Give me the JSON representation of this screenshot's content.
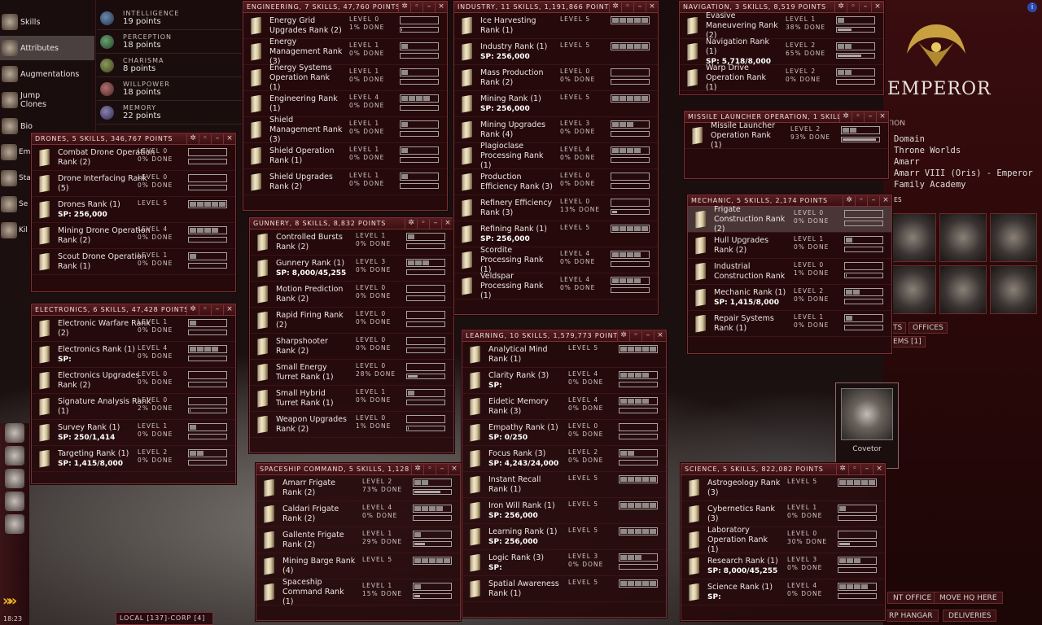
{
  "nav": {
    "items": [
      {
        "label": "Skills"
      },
      {
        "label": "Attributes"
      },
      {
        "label": "Augmentations"
      },
      {
        "label": "Jump\nClones"
      },
      {
        "label": "Bio"
      }
    ],
    "cut_items": [
      {
        "label": "Em His"
      },
      {
        "label": "Sta"
      },
      {
        "label": "Se Sta"
      },
      {
        "label": "Kil Rig"
      }
    ]
  },
  "attributes": [
    {
      "name": "INTELLIGENCE",
      "points": "19 points"
    },
    {
      "name": "PERCEPTION",
      "points": "18 points"
    },
    {
      "name": "CHARISMA",
      "points": "8 points"
    },
    {
      "name": "WILLPOWER",
      "points": "18 points"
    },
    {
      "name": "MEMORY",
      "points": "22 points"
    }
  ],
  "corp": {
    "title": "EMPEROR",
    "section_label": "TION",
    "lines": [
      "Domain",
      "Throne Worlds",
      "Amarr",
      "Amarr VIII (Oris) - Emperor",
      "Family Academy"
    ],
    "es_label": "ES",
    "tabs": [
      "TS",
      "OFFICES",
      "EMS [1]"
    ],
    "covetor": "Covetor",
    "buttons": [
      "NT OFFICE",
      "MOVE HQ HERE",
      "RP HANGAR",
      "DELIVERIES"
    ]
  },
  "misc": {
    "time": "18:23",
    "local_chat": "LOCAL [137]-CORP [4]",
    "info": "i",
    "chevrons": "»»"
  },
  "windows": {
    "drones": {
      "title": "DRONES, 5 SKILLS, 346,767 POINTS",
      "skills": [
        {
          "name": "Combat Drone Operation Rank (2)",
          "level": 0,
          "level_text": "LEVEL 0",
          "done_text": "0% DONE",
          "progress": 0
        },
        {
          "name": "Drone Interfacing Rank (5)",
          "level": 0,
          "level_text": "LEVEL 0",
          "done_text": "0% DONE",
          "progress": 0
        },
        {
          "name": "Drones Rank (1)",
          "level": 5,
          "level_text": "LEVEL 5",
          "done_text": "",
          "progress": null,
          "sp": "SP: 256,000"
        },
        {
          "name": "Mining Drone Operation Rank (2)",
          "level": 4,
          "level_text": "LEVEL 4",
          "done_text": "0% DONE",
          "progress": 0
        },
        {
          "name": "Scout Drone Operation Rank (1)",
          "level": 1,
          "level_text": "LEVEL 1",
          "done_text": "0% DONE",
          "progress": 0
        }
      ]
    },
    "electronics": {
      "title": "ELECTRONICS, 6 SKILLS, 47,428 POINTS",
      "skills": [
        {
          "name": "Electronic Warfare Rank (2)",
          "level": 1,
          "level_text": "LEVEL 1",
          "done_text": "0% DONE",
          "progress": 0
        },
        {
          "name": "Electronics Rank (1)",
          "level": 4,
          "level_text": "LEVEL 4",
          "done_text": "0% DONE",
          "progress": 0,
          "sp": "SP:"
        },
        {
          "name": "Electronics Upgrades Rank (2)",
          "level": 0,
          "level_text": "LEVEL 0",
          "done_text": "0% DONE",
          "progress": 0
        },
        {
          "name": "Signature Analysis Rank (1)",
          "level": 0,
          "level_text": "LEVEL 0",
          "done_text": "2% DONE",
          "progress": 2
        },
        {
          "name": "Survey Rank (1)",
          "level": 1,
          "level_text": "LEVEL 1",
          "done_text": "0% DONE",
          "progress": 0,
          "sp": "SP: 250/1,414"
        },
        {
          "name": "Targeting Rank (1)",
          "level": 2,
          "level_text": "LEVEL 2",
          "done_text": "0% DONE",
          "progress": 0,
          "sp": "SP: 1,415/8,000"
        }
      ]
    },
    "engineering": {
      "title": "ENGINEERING, 7 SKILLS, 47,760 POINTS",
      "skills": [
        {
          "name": "Energy Grid Upgrades Rank (2)",
          "level": 0,
          "level_text": "LEVEL 0",
          "done_text": "1% DONE",
          "progress": 1
        },
        {
          "name": "Energy Management Rank (3)",
          "level": 1,
          "level_text": "LEVEL 1",
          "done_text": "0% DONE",
          "progress": 0
        },
        {
          "name": "Energy Systems Operation Rank (1)",
          "level": 1,
          "level_text": "LEVEL 1",
          "done_text": "0% DONE",
          "progress": 0
        },
        {
          "name": "Engineering Rank (1)",
          "level": 4,
          "level_text": "LEVEL 4",
          "done_text": "0% DONE",
          "progress": 0
        },
        {
          "name": "Shield Management Rank (3)",
          "level": 1,
          "level_text": "LEVEL 1",
          "done_text": "0% DONE",
          "progress": 0
        },
        {
          "name": "Shield Operation Rank (1)",
          "level": 1,
          "level_text": "LEVEL 1",
          "done_text": "0% DONE",
          "progress": 0
        },
        {
          "name": "Shield Upgrades Rank (2)",
          "level": 1,
          "level_text": "LEVEL 1",
          "done_text": "0% DONE",
          "progress": 0
        }
      ]
    },
    "gunnery": {
      "title": "GUNNERY, 8 SKILLS, 8,832 POINTS",
      "skills": [
        {
          "name": "Controlled Bursts Rank (2)",
          "level": 1,
          "level_text": "LEVEL 1",
          "done_text": "0% DONE",
          "progress": 0
        },
        {
          "name": "Gunnery Rank (1)",
          "level": 3,
          "level_text": "LEVEL 3",
          "done_text": "0% DONE",
          "progress": 0,
          "sp": "SP: 8,000/45,255"
        },
        {
          "name": "Motion Prediction Rank (2)",
          "level": 0,
          "level_text": "LEVEL 0",
          "done_text": "0% DONE",
          "progress": 0
        },
        {
          "name": "Rapid Firing Rank (2)",
          "level": 0,
          "level_text": "LEVEL 0",
          "done_text": "0% DONE",
          "progress": 0
        },
        {
          "name": "Sharpshooter Rank (2)",
          "level": 0,
          "level_text": "LEVEL 0",
          "done_text": "0% DONE",
          "progress": 0
        },
        {
          "name": "Small Energy Turret Rank (1)",
          "level": 0,
          "level_text": "LEVEL 0",
          "done_text": "28% DONE",
          "progress": 28
        },
        {
          "name": "Small Hybrid Turret Rank (1)",
          "level": 1,
          "level_text": "LEVEL 1",
          "done_text": "0% DONE",
          "progress": 0
        },
        {
          "name": "Weapon Upgrades Rank (2)",
          "level": 0,
          "level_text": "LEVEL 0",
          "done_text": "1% DONE",
          "progress": 1
        }
      ]
    },
    "spaceship": {
      "title": "SPACESHIP COMMAND, 5 SKILLS, 1,128",
      "skills": [
        {
          "name": "Amarr Frigate Rank (2)",
          "level": 2,
          "level_text": "LEVEL 2",
          "done_text": "73% DONE",
          "progress": 73
        },
        {
          "name": "Caldari Frigate Rank (2)",
          "level": 4,
          "level_text": "LEVEL 4",
          "done_text": "0% DONE",
          "progress": 0
        },
        {
          "name": "Gallente Frigate Rank (2)",
          "level": 1,
          "level_text": "LEVEL 1",
          "done_text": "29% DONE",
          "progress": 29
        },
        {
          "name": "Mining Barge Rank (4)",
          "level": 5,
          "level_text": "LEVEL 5",
          "done_text": "",
          "progress": null
        },
        {
          "name": "Spaceship Command Rank (1)",
          "level": 1,
          "level_text": "LEVEL 1",
          "done_text": "15% DONE",
          "progress": 15
        }
      ]
    },
    "industry": {
      "title": "INDUSTRY, 11 SKILLS, 1,191,866 POINTS",
      "skills": [
        {
          "name": "Ice Harvesting Rank (1)",
          "level": 5,
          "level_text": "LEVEL 5",
          "done_text": "",
          "progress": null
        },
        {
          "name": "Industry Rank (1)",
          "level": 5,
          "level_text": "LEVEL 5",
          "done_text": "",
          "progress": null,
          "sp": "SP: 256,000"
        },
        {
          "name": "Mass Production Rank (2)",
          "level": 0,
          "level_text": "LEVEL 0",
          "done_text": "0% DONE",
          "progress": 0
        },
        {
          "name": "Mining Rank (1)",
          "level": 5,
          "level_text": "LEVEL 5",
          "done_text": "",
          "progress": null,
          "sp": "SP: 256,000"
        },
        {
          "name": "Mining Upgrades Rank (4)",
          "level": 3,
          "level_text": "LEVEL 3",
          "done_text": "0% DONE",
          "progress": 0
        },
        {
          "name": "Plagioclase Processing Rank (1)",
          "level": 4,
          "level_text": "LEVEL 4",
          "done_text": "0% DONE",
          "progress": 0
        },
        {
          "name": "Production Efficiency Rank (3)",
          "level": 0,
          "level_text": "LEVEL 0",
          "done_text": "0% DONE",
          "progress": 0
        },
        {
          "name": "Refinery Efficiency Rank (3)",
          "level": 0,
          "level_text": "LEVEL 0",
          "done_text": "13% DONE",
          "progress": 13
        },
        {
          "name": "Refining Rank (1)",
          "level": 5,
          "level_text": "LEVEL 5",
          "done_text": "",
          "progress": null,
          "sp": "SP: 256,000"
        },
        {
          "name": "Scordite Processing Rank (1)",
          "level": 4,
          "level_text": "LEVEL 4",
          "done_text": "0% DONE",
          "progress": 0
        },
        {
          "name": "Veldspar Processing Rank (1)",
          "level": 4,
          "level_text": "LEVEL 4",
          "done_text": "0% DONE",
          "progress": 0
        }
      ]
    },
    "learning": {
      "title": "LEARNING, 10 SKILLS, 1,579,773 POINTS",
      "skills": [
        {
          "name": "Analytical Mind Rank (1)",
          "level": 5,
          "level_text": "LEVEL 5",
          "done_text": "",
          "progress": null
        },
        {
          "name": "Clarity Rank (3)",
          "level": 4,
          "level_text": "LEVEL 4",
          "done_text": "0% DONE",
          "progress": 0,
          "sp": "SP:"
        },
        {
          "name": "Eidetic Memory Rank (3)",
          "level": 4,
          "level_text": "LEVEL 4",
          "done_text": "0% DONE",
          "progress": 0
        },
        {
          "name": "Empathy Rank (1)",
          "level": 0,
          "level_text": "LEVEL 0",
          "done_text": "0% DONE",
          "progress": 0,
          "sp": "SP: 0/250"
        },
        {
          "name": "Focus Rank (3)",
          "level": 2,
          "level_text": "LEVEL 2",
          "done_text": "0% DONE",
          "progress": 0,
          "sp": "SP: 4,243/24,000"
        },
        {
          "name": "Instant Recall Rank (1)",
          "level": 5,
          "level_text": "LEVEL 5",
          "done_text": "",
          "progress": null
        },
        {
          "name": "Iron Will Rank (1)",
          "level": 5,
          "level_text": "LEVEL 5",
          "done_text": "",
          "progress": null,
          "sp": "SP: 256,000"
        },
        {
          "name": "Learning Rank (1)",
          "level": 5,
          "level_text": "LEVEL 5",
          "done_text": "",
          "progress": null,
          "sp": "SP: 256,000"
        },
        {
          "name": "Logic Rank (3)",
          "level": 3,
          "level_text": "LEVEL 3",
          "done_text": "0% DONE",
          "progress": 0,
          "sp": "SP:"
        },
        {
          "name": "Spatial Awareness Rank (1)",
          "level": 5,
          "level_text": "LEVEL 5",
          "done_text": "",
          "progress": null
        }
      ]
    },
    "navigation": {
      "title": "NAVIGATION, 3 SKILLS, 8,519 POINTS",
      "skills": [
        {
          "name": "Evasive Maneuvering Rank (2)",
          "level": 1,
          "level_text": "LEVEL 1",
          "done_text": "38% DONE",
          "progress": 38
        },
        {
          "name": "Navigation Rank (1)",
          "level": 2,
          "level_text": "LEVEL 2",
          "done_text": "65% DONE",
          "progress": 65,
          "sp": "SP: 5,718/8,000"
        },
        {
          "name": "Warp Drive Operation Rank (1)",
          "level": 2,
          "level_text": "LEVEL 2",
          "done_text": "0% DONE",
          "progress": 0
        }
      ]
    },
    "missile": {
      "title": "MISSILE LAUNCHER OPERATION, 1 SKILL",
      "skills": [
        {
          "name": "Missile Launcher Operation Rank (1)",
          "level": 2,
          "level_text": "LEVEL 2",
          "done_text": "93% DONE",
          "progress": 93
        }
      ]
    },
    "mechanic": {
      "title": "MECHANIC, 5 SKILLS, 2,174 POINTS",
      "skills": [
        {
          "name": "Frigate Construction Rank (2)",
          "level": 0,
          "level_text": "LEVEL 0",
          "done_text": "0% DONE",
          "progress": 0,
          "selected": true
        },
        {
          "name": "Hull Upgrades Rank (2)",
          "level": 1,
          "level_text": "LEVEL 1",
          "done_text": "0% DONE",
          "progress": 0
        },
        {
          "name": "Industrial Construction Rank",
          "level": 0,
          "level_text": "LEVEL 0",
          "done_text": "1% DONE",
          "progress": 1
        },
        {
          "name": "Mechanic Rank (1)",
          "level": 2,
          "level_text": "LEVEL 2",
          "done_text": "0% DONE",
          "progress": 0,
          "sp": "SP: 1,415/8,000"
        },
        {
          "name": "Repair Systems Rank (1)",
          "level": 1,
          "level_text": "LEVEL 1",
          "done_text": "0% DONE",
          "progress": 0
        }
      ]
    },
    "science": {
      "title": "SCIENCE, 5 SKILLS, 822,082 POINTS",
      "skills": [
        {
          "name": "Astrogeology Rank (3)",
          "level": 5,
          "level_text": "LEVEL 5",
          "done_text": "",
          "progress": null
        },
        {
          "name": "Cybernetics Rank (3)",
          "level": 1,
          "level_text": "LEVEL 1",
          "done_text": "0% DONE",
          "progress": 0
        },
        {
          "name": "Laboratory Operation Rank (1)",
          "level": 0,
          "level_text": "LEVEL 0",
          "done_text": "30% DONE",
          "progress": 30
        },
        {
          "name": "Research Rank (1)",
          "level": 3,
          "level_text": "LEVEL 3",
          "done_text": "0% DONE",
          "progress": 0,
          "sp": "SP: 8,000/45,255"
        },
        {
          "name": "Science Rank (1)",
          "level": 4,
          "level_text": "LEVEL 4",
          "done_text": "0% DONE",
          "progress": 0,
          "sp": "SP:"
        }
      ]
    }
  }
}
